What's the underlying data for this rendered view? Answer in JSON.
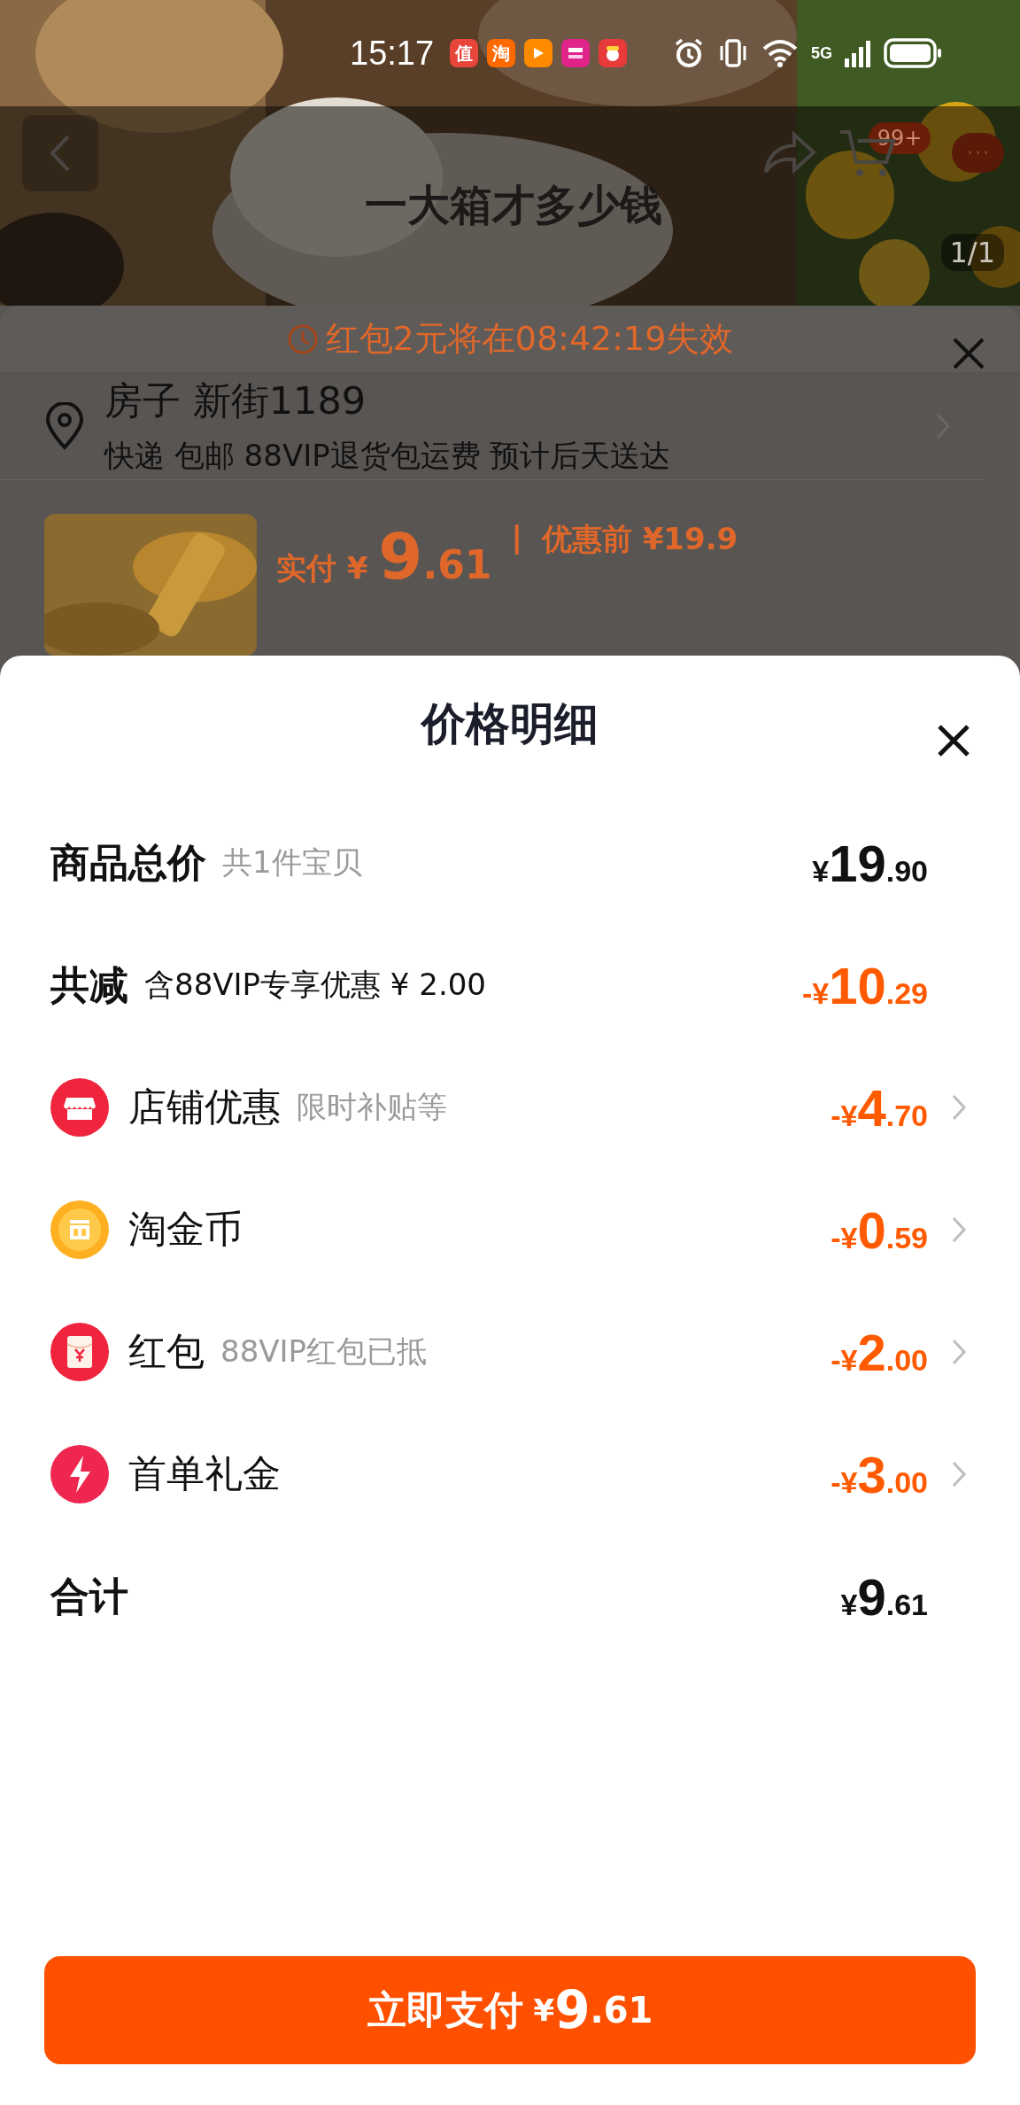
{
  "status_bar": {
    "time": "15:17",
    "network": "5G",
    "apps": [
      {
        "kind": "glyph",
        "label": "值",
        "color": "#e8463a"
      },
      {
        "kind": "glyph",
        "label": "淘",
        "color": "#ff6a00"
      },
      {
        "kind": "play",
        "color": "#ff8a00"
      },
      {
        "kind": "badge",
        "color": "#e0248a"
      },
      {
        "kind": "mascot",
        "color": "#e83a3a"
      }
    ]
  },
  "nav": {
    "title": "一大箱才多少钱",
    "cart_badge": "99+",
    "more": "···",
    "image_counter": "1/1"
  },
  "order": {
    "countdown": "红包2元将在08:42:19失效",
    "address": {
      "name": "房子 新街1189",
      "delivery": "快递 包邮 88VIP退货包运费 预计后天送达"
    },
    "price": {
      "paid_label": "实付",
      "symbol": "¥",
      "main": "9",
      "cents": ".61",
      "separator": "|",
      "before": "优惠前 ¥19.9"
    }
  },
  "price_detail": {
    "title": "价格明细",
    "rows": [
      {
        "kind": "total",
        "label": "商品总价",
        "note": "共1件宝贝",
        "amount": {
          "symbol": "¥",
          "main": "19",
          "cents": ".90"
        }
      },
      {
        "kind": "reduction",
        "label": "共减",
        "note": "含88VIP专享优惠 ¥ 2.00",
        "amount": {
          "sign": "-",
          "symbol": "¥",
          "main": "10",
          "cents": ".29"
        }
      },
      {
        "kind": "discount",
        "label": "店铺优惠",
        "note": "限时补贴等",
        "amount": {
          "sign": "-",
          "symbol": "¥",
          "main": "4",
          "cents": ".70"
        }
      },
      {
        "kind": "discount",
        "label": "淘金币",
        "amount": {
          "sign": "-",
          "symbol": "¥",
          "main": "0",
          "cents": ".59"
        }
      },
      {
        "kind": "discount",
        "label": "红包",
        "note": "88VIP红包已抵",
        "amount": {
          "sign": "-",
          "symbol": "¥",
          "main": "2",
          "cents": ".00"
        }
      },
      {
        "kind": "discount",
        "label": "首单礼金",
        "amount": {
          "sign": "-",
          "symbol": "¥",
          "main": "3",
          "cents": ".00"
        }
      },
      {
        "kind": "total",
        "label": "合计",
        "amount": {
          "symbol": "¥",
          "main": "9",
          "cents": ".61"
        }
      }
    ],
    "pay_button": {
      "label": "立即支付",
      "symbol": "¥",
      "main": "9",
      "cents": ".61"
    }
  }
}
